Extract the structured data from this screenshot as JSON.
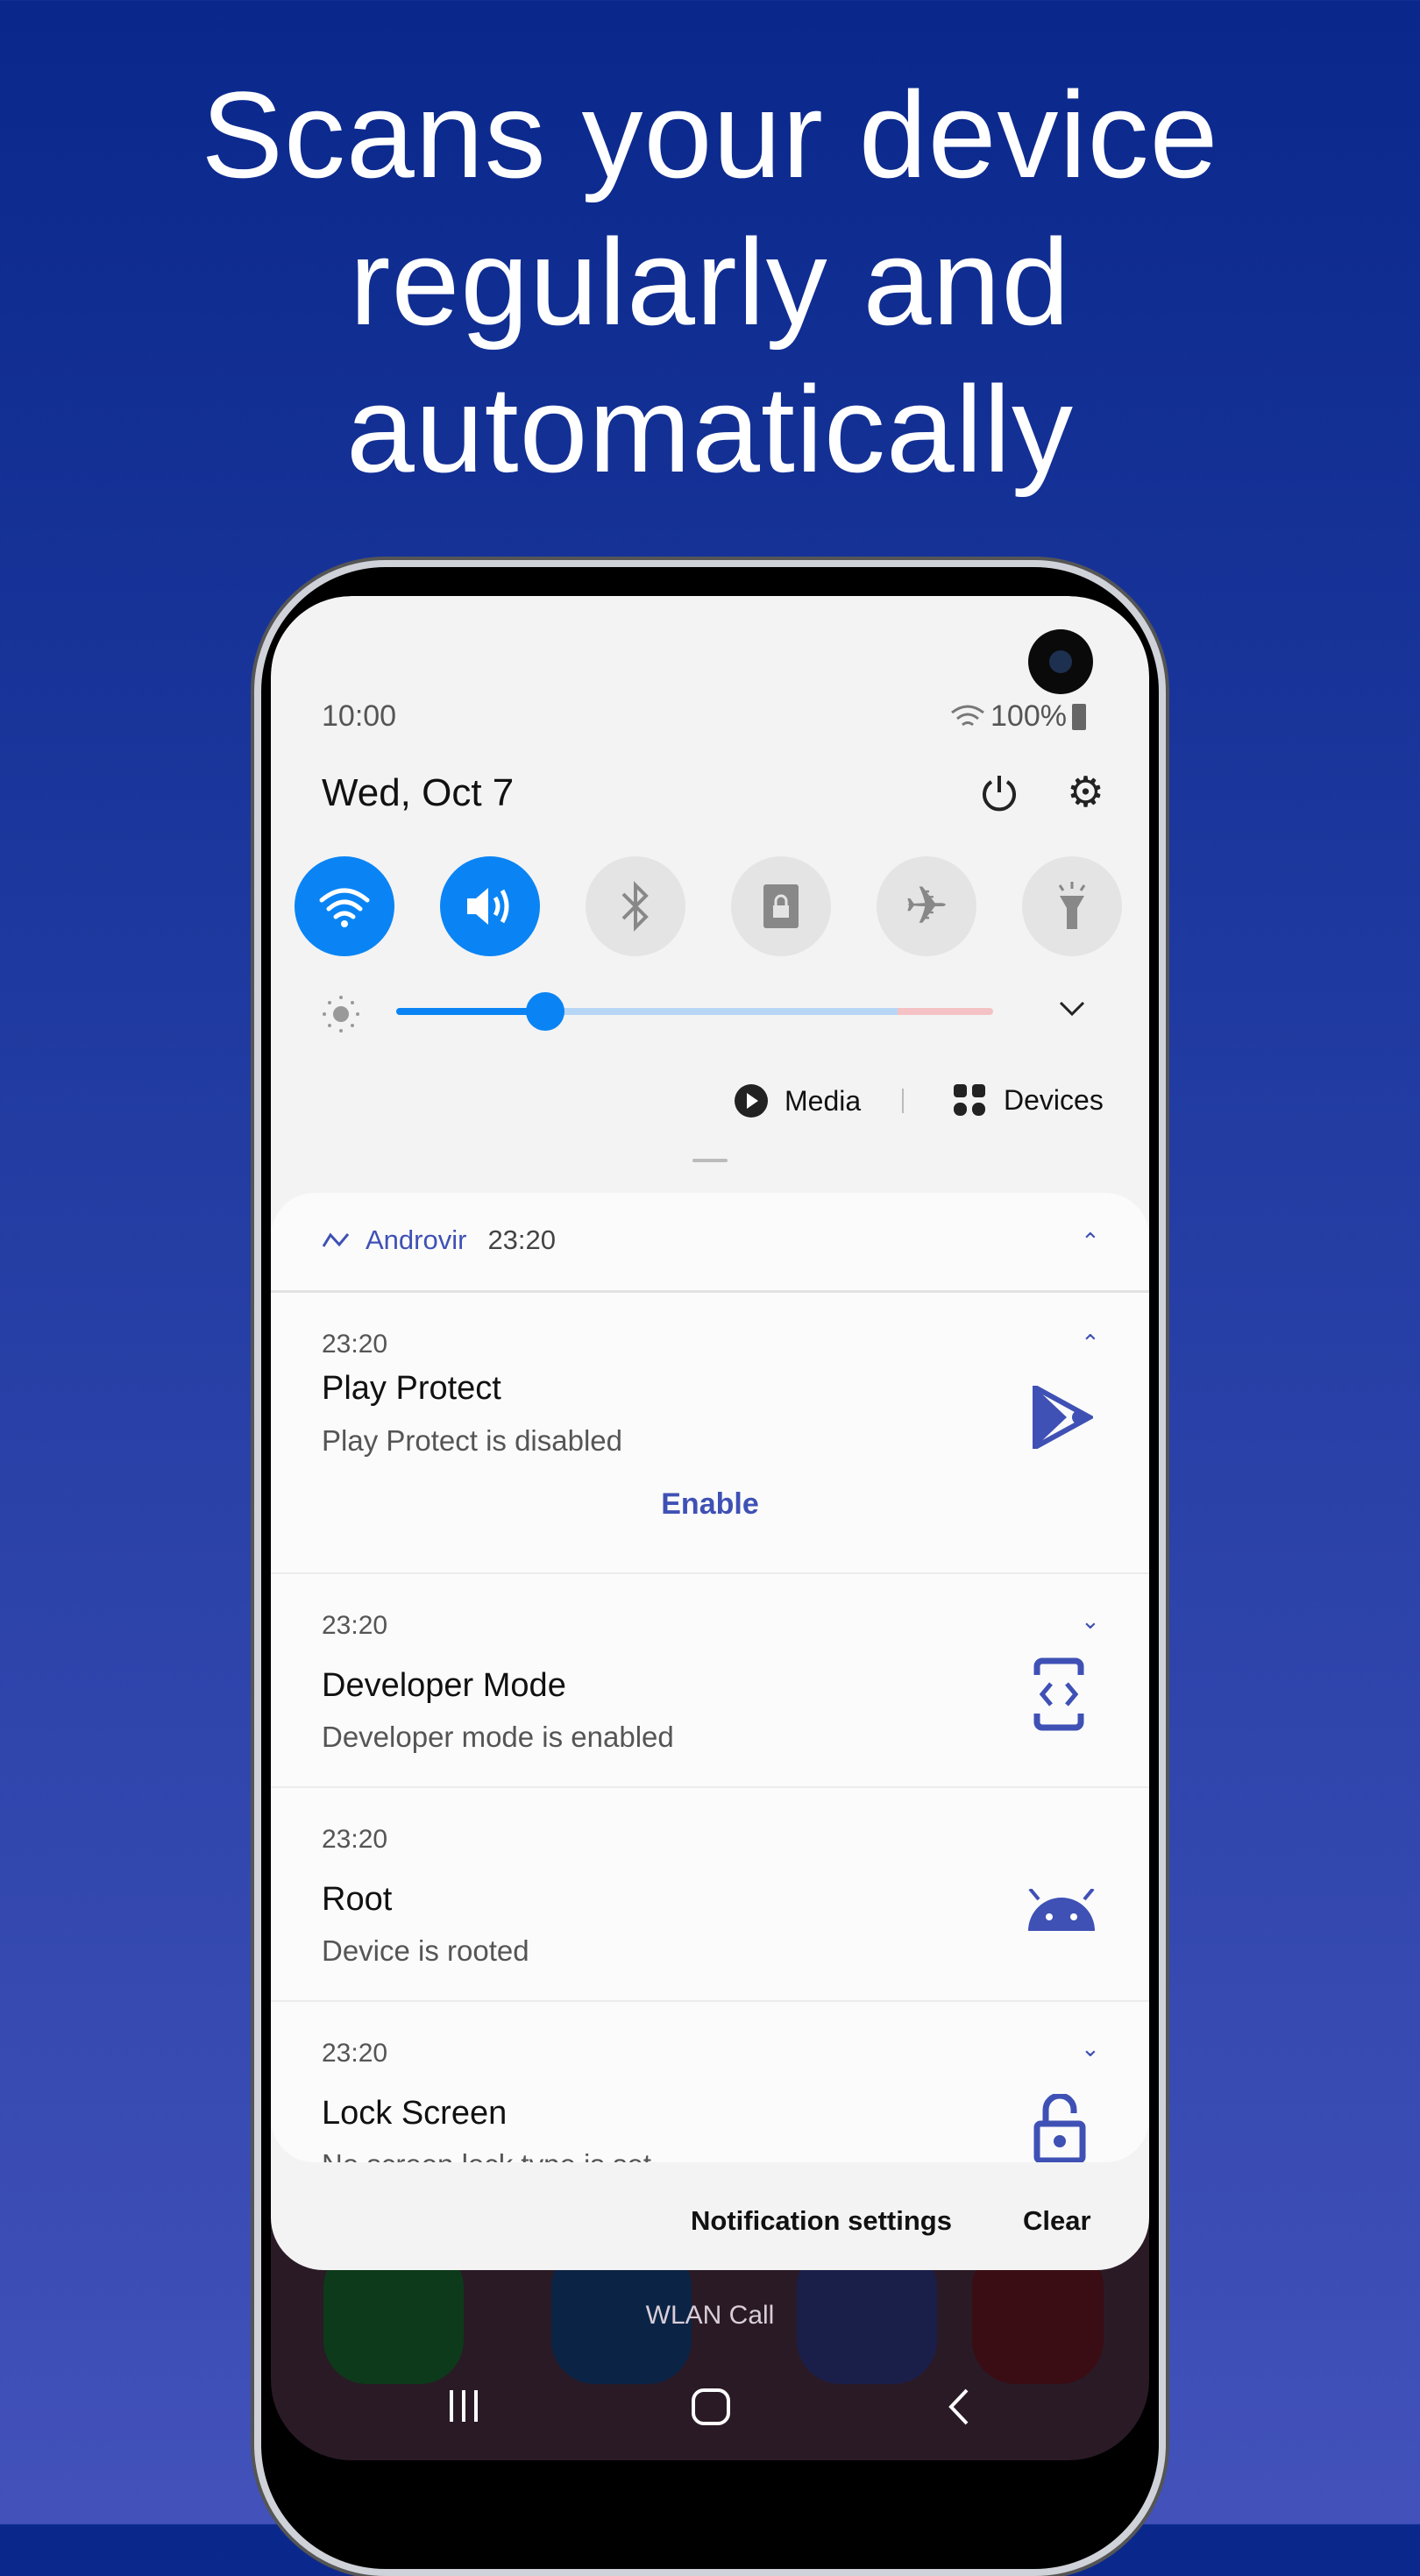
{
  "headline": [
    "Scans your device",
    "regularly and",
    "automatically"
  ],
  "status": {
    "time": "10:00",
    "battery": "100%"
  },
  "date": "Wed, Oct 7",
  "toggles": [
    {
      "icon": "wifi-icon",
      "on": true
    },
    {
      "icon": "sound-icon",
      "on": true
    },
    {
      "icon": "bluetooth-icon",
      "on": false
    },
    {
      "icon": "screen-lock-icon",
      "on": false
    },
    {
      "icon": "airplane-icon",
      "on": false
    },
    {
      "icon": "flashlight-icon",
      "on": false
    }
  ],
  "brightness": {
    "value": 0.25
  },
  "media_label": "Media",
  "devices_label": "Devices",
  "notification_group": {
    "app": "Androvir",
    "time": "23:20"
  },
  "notifications": [
    {
      "time": "23:20",
      "title": "Play Protect",
      "text": "Play Protect is disabled",
      "action": "Enable",
      "icon": "play-protect-icon"
    },
    {
      "time": "23:20",
      "title": "Developer Mode",
      "text": "Developer mode is enabled",
      "icon": "developer-icon"
    },
    {
      "time": "23:20",
      "title": "Root",
      "text": "Device is rooted",
      "icon": "android-icon"
    },
    {
      "time": "23:20",
      "title": "Lock Screen",
      "text": "No screen lock type is set",
      "icon": "unlock-icon"
    }
  ],
  "footer": {
    "settings": "Notification settings",
    "clear": "Clear"
  },
  "home": {
    "label": "WLAN Call"
  },
  "colors": {
    "accent": "#0a84f4",
    "brand": "#3f51b5"
  }
}
